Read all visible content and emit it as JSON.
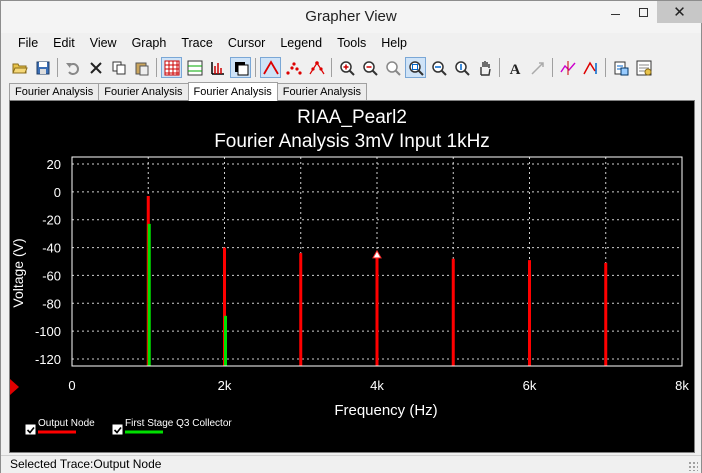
{
  "window": {
    "title": "Grapher View"
  },
  "menu": [
    "File",
    "Edit",
    "View",
    "Graph",
    "Trace",
    "Cursor",
    "Legend",
    "Tools",
    "Help"
  ],
  "toolbar": {
    "buttons": [
      {
        "icon": "open-folder-icon"
      },
      {
        "icon": "save-icon"
      },
      {
        "sep": true
      },
      {
        "icon": "undo-icon"
      },
      {
        "icon": "delete-icon"
      },
      {
        "icon": "copy-icon"
      },
      {
        "icon": "paste-icon"
      },
      {
        "sep": true
      },
      {
        "icon": "major-grid-icon",
        "pressed": true
      },
      {
        "icon": "minor-grid-icon"
      },
      {
        "icon": "ruler-icon"
      },
      {
        "icon": "toggle-color-icon",
        "pressed": true
      },
      {
        "sep": true
      },
      {
        "icon": "line-plot-icon",
        "pressed": true
      },
      {
        "icon": "scatter-plot-icon"
      },
      {
        "icon": "line-scatter-icon"
      },
      {
        "sep": true
      },
      {
        "icon": "zoom-in-icon"
      },
      {
        "icon": "zoom-out-icon"
      },
      {
        "icon": "zoom-previous-icon"
      },
      {
        "icon": "zoom-area-icon",
        "pressed": true
      },
      {
        "icon": "zoom-x-icon"
      },
      {
        "icon": "zoom-y-icon"
      },
      {
        "icon": "pan-hand-icon"
      },
      {
        "sep": true
      },
      {
        "icon": "text-annotation-icon"
      },
      {
        "icon": "arrow-annotation-icon"
      },
      {
        "sep": true
      },
      {
        "icon": "cursor-icon"
      },
      {
        "icon": "next-peak-icon"
      },
      {
        "sep": true
      },
      {
        "icon": "export-icon"
      },
      {
        "icon": "properties-icon"
      }
    ]
  },
  "tabs": [
    {
      "label": "Fourier Analysis",
      "active": false
    },
    {
      "label": "Fourier Analysis",
      "active": false
    },
    {
      "label": "Fourier Analysis",
      "active": true
    },
    {
      "label": "Fourier Analysis",
      "active": false
    }
  ],
  "chart_data": {
    "type": "bar",
    "title": "RIAA_Pearl2",
    "subtitle": "Fourier Analysis 3mV Input 1kHz",
    "xlabel": "Frequency (Hz)",
    "ylabel": "Voltage (V)",
    "xlim": [
      0,
      8000
    ],
    "ylim": [
      -125,
      25
    ],
    "baseline": -125,
    "x_ticks": [
      0,
      2000,
      4000,
      6000,
      8000
    ],
    "x_tick_labels": [
      "0",
      "2k",
      "4k",
      "6k",
      "8k"
    ],
    "y_ticks": [
      20,
      0,
      -20,
      -40,
      -60,
      -80,
      -100,
      -120
    ],
    "y_tick_labels": [
      "20",
      "0",
      "-20",
      "-40",
      "-60",
      "-80",
      "-100",
      "-120"
    ],
    "grid": true,
    "legend_position": "bottom-left",
    "cursor_marker": {
      "x": 4000,
      "y": -46
    },
    "colors": {
      "background": "#000000",
      "text": "#ffffff",
      "grid": "#d0d0d0"
    },
    "series": [
      {
        "name": "Output Node",
        "color": "#ff0000",
        "x": [
          1000,
          2000,
          3000,
          4000,
          5000,
          6000,
          7000
        ],
        "values": [
          -3,
          -40,
          -44,
          -46,
          -48,
          -49,
          -51
        ]
      },
      {
        "name": "First Stage Q3 Collector",
        "color": "#00e000",
        "x": [
          1000,
          2000
        ],
        "values": [
          -23,
          -89
        ]
      }
    ]
  },
  "status": {
    "text": "Selected Trace:Output Node"
  }
}
